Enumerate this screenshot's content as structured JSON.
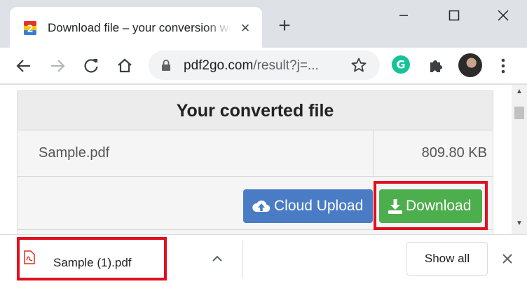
{
  "browser": {
    "tab": {
      "title": "Download file – your conversion was successful",
      "favicon_text": "2"
    },
    "address_bar": {
      "domain": "pdf2go.com",
      "path": "/result?j=..."
    },
    "extensions": {
      "grammarly_letter": "G"
    }
  },
  "page": {
    "title": "Your converted file",
    "file": {
      "name": "Sample.pdf",
      "size": "809.80 KB"
    },
    "buttons": {
      "cloud_upload": "Cloud Upload",
      "download": "Download"
    }
  },
  "download_shelf": {
    "item_name": "Sample (1).pdf",
    "show_all_label": "Show all"
  },
  "colors": {
    "cloud_button": "#4a7cc6",
    "download_button": "#4cae4c",
    "highlight": "#e0101e",
    "grammarly": "#15c39a"
  }
}
